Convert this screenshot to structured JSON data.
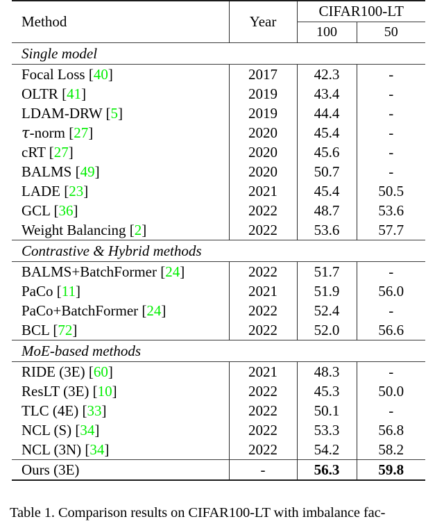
{
  "table": {
    "headers": {
      "method": "Method",
      "year": "Year",
      "group": "CIFAR100-LT",
      "sub_100": "100",
      "sub_50": "50"
    },
    "sections": [
      {
        "title": "Single model",
        "rows": [
          {
            "method": "Focal Loss",
            "cite": "40",
            "year": "2017",
            "v100": "42.3",
            "v50": "-"
          },
          {
            "method": "OLTR",
            "cite": "41",
            "year": "2019",
            "v100": "43.4",
            "v50": "-"
          },
          {
            "method": "LDAM-DRW",
            "cite": "5",
            "year": "2019",
            "v100": "44.4",
            "v50": "-"
          },
          {
            "method": "τ-norm",
            "cite": "27",
            "year": "2020",
            "v100": "45.4",
            "v50": "-"
          },
          {
            "method": "cRT",
            "cite": "27",
            "year": "2020",
            "v100": "45.6",
            "v50": "-"
          },
          {
            "method": "BALMS",
            "cite": "49",
            "year": "2020",
            "v100": "50.7",
            "v50": "-"
          },
          {
            "method": "LADE",
            "cite": "23",
            "year": "2021",
            "v100": "45.4",
            "v50": "50.5"
          },
          {
            "method": "GCL",
            "cite": "36",
            "year": "2022",
            "v100": "48.7",
            "v50": "53.6"
          },
          {
            "method": "Weight Balancing",
            "cite": "2",
            "year": "2022",
            "v100": "53.6",
            "v50": "57.7"
          }
        ]
      },
      {
        "title": "Contrastive & Hybrid methods",
        "rows": [
          {
            "method": "BALMS+BatchFormer",
            "cite": "24",
            "year": "2022",
            "v100": "51.7",
            "v50": "-"
          },
          {
            "method": "PaCo",
            "cite": "11",
            "year": "2021",
            "v100": "51.9",
            "v50": "56.0"
          },
          {
            "method": "PaCo+BatchFormer",
            "cite": "24",
            "year": "2022",
            "v100": "52.4",
            "v50": "-"
          },
          {
            "method": "BCL",
            "cite": "72",
            "year": "2022",
            "v100": "52.0",
            "v50": "56.6"
          }
        ]
      },
      {
        "title": "MoE-based methods",
        "rows": [
          {
            "method": "RIDE (3E)",
            "cite": "60",
            "year": "2021",
            "v100": "48.3",
            "v50": "-"
          },
          {
            "method": "ResLT (3E)",
            "cite": "10",
            "year": "2022",
            "v100": "45.3",
            "v50": "50.0"
          },
          {
            "method": "TLC (4E)",
            "cite": "33",
            "year": "2022",
            "v100": "50.1",
            "v50": "-"
          },
          {
            "method": "NCL (S)",
            "cite": "34",
            "year": "2022",
            "v100": "53.3",
            "v50": "56.8"
          },
          {
            "method": "NCL (3N)",
            "cite": "34",
            "year": "2022",
            "v100": "54.2",
            "v50": "58.2"
          }
        ]
      }
    ],
    "ours_row": {
      "method": "Ours (3E)",
      "cite": "",
      "year": "-",
      "v100": "56.3",
      "v50": "59.8"
    }
  },
  "caption": "Table 1. Comparison results on CIFAR100-LT with imbalance fac-",
  "colors": {
    "citation_green": "#00ee00",
    "rule_dark": "#1a1a1a",
    "rule_mid": "#3a3a3a",
    "text": "#000000"
  }
}
